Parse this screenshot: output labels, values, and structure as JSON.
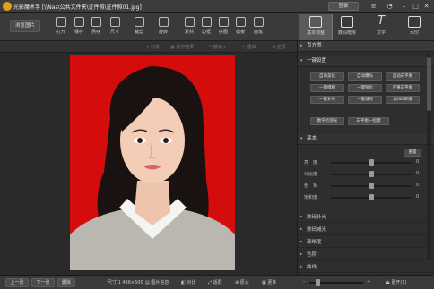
{
  "window": {
    "title": "光影魔术手  [\\\\Nas\\公共文件夹\\证件照\\证件照01.jpg]",
    "login_label": "登录"
  },
  "toolbar": {
    "browse_label": "浏览图片",
    "tools": [
      {
        "label": "打开",
        "icon": "folder-icon"
      },
      {
        "label": "保存",
        "icon": "save-icon"
      },
      {
        "label": "另存",
        "icon": "save-as-icon"
      },
      {
        "label": "尺寸",
        "icon": "resize-icon"
      },
      {
        "label": "裁剪",
        "icon": "crop-icon"
      },
      {
        "label": "旋转",
        "icon": "rotate-icon"
      },
      {
        "label": "素材",
        "icon": "materials-icon"
      },
      {
        "label": "边框",
        "icon": "border-icon"
      },
      {
        "label": "拼图",
        "icon": "collage-icon"
      },
      {
        "label": "模板",
        "icon": "template-icon"
      },
      {
        "label": "画笔",
        "icon": "brush-icon"
      }
    ],
    "tabs": [
      {
        "label": "基本调整",
        "icon": "sliders-icon",
        "active": true
      },
      {
        "label": "数码暗房",
        "icon": "darkroom-icon",
        "active": false
      },
      {
        "label": "文字",
        "icon": "text-icon",
        "active": false
      },
      {
        "label": "水印",
        "icon": "watermark-icon",
        "active": false
      }
    ]
  },
  "subbar": {
    "share": "分享",
    "save_result": "保存结果",
    "undo": "撤销",
    "redo": "重做",
    "restore": "还原"
  },
  "panel": {
    "histogram": "直方图",
    "one_click_title": "一键设置",
    "one_click_buttons": [
      "自动美化",
      "自动曝光",
      "自动白平衡",
      "一键模糊",
      "一键锐化",
      "严重白平衡",
      "一键补光",
      "一键减光",
      "高ISO降噪",
      "数字点测光",
      "白平衡一指键"
    ],
    "basic_title": "基本",
    "reset_label": "重置",
    "sliders": [
      {
        "label": "亮　度",
        "value": "0"
      },
      {
        "label": "对比度",
        "value": "0"
      },
      {
        "label": "色　相",
        "value": "0"
      },
      {
        "label": "饱和度",
        "value": "0"
      }
    ],
    "collapsed_sections": [
      "数码补光",
      "数码减光",
      "清晰度",
      "色阶",
      "曲线"
    ]
  },
  "status": {
    "prev": "上一张",
    "next": "下一张",
    "delete": "删除",
    "size_label": "尺寸",
    "size_value": "1 436×500",
    "info": "图片信息",
    "compare": "对比",
    "fit": "适屏",
    "zoom_in": "原大",
    "more": "更多",
    "restore_label": "更开(1)"
  }
}
